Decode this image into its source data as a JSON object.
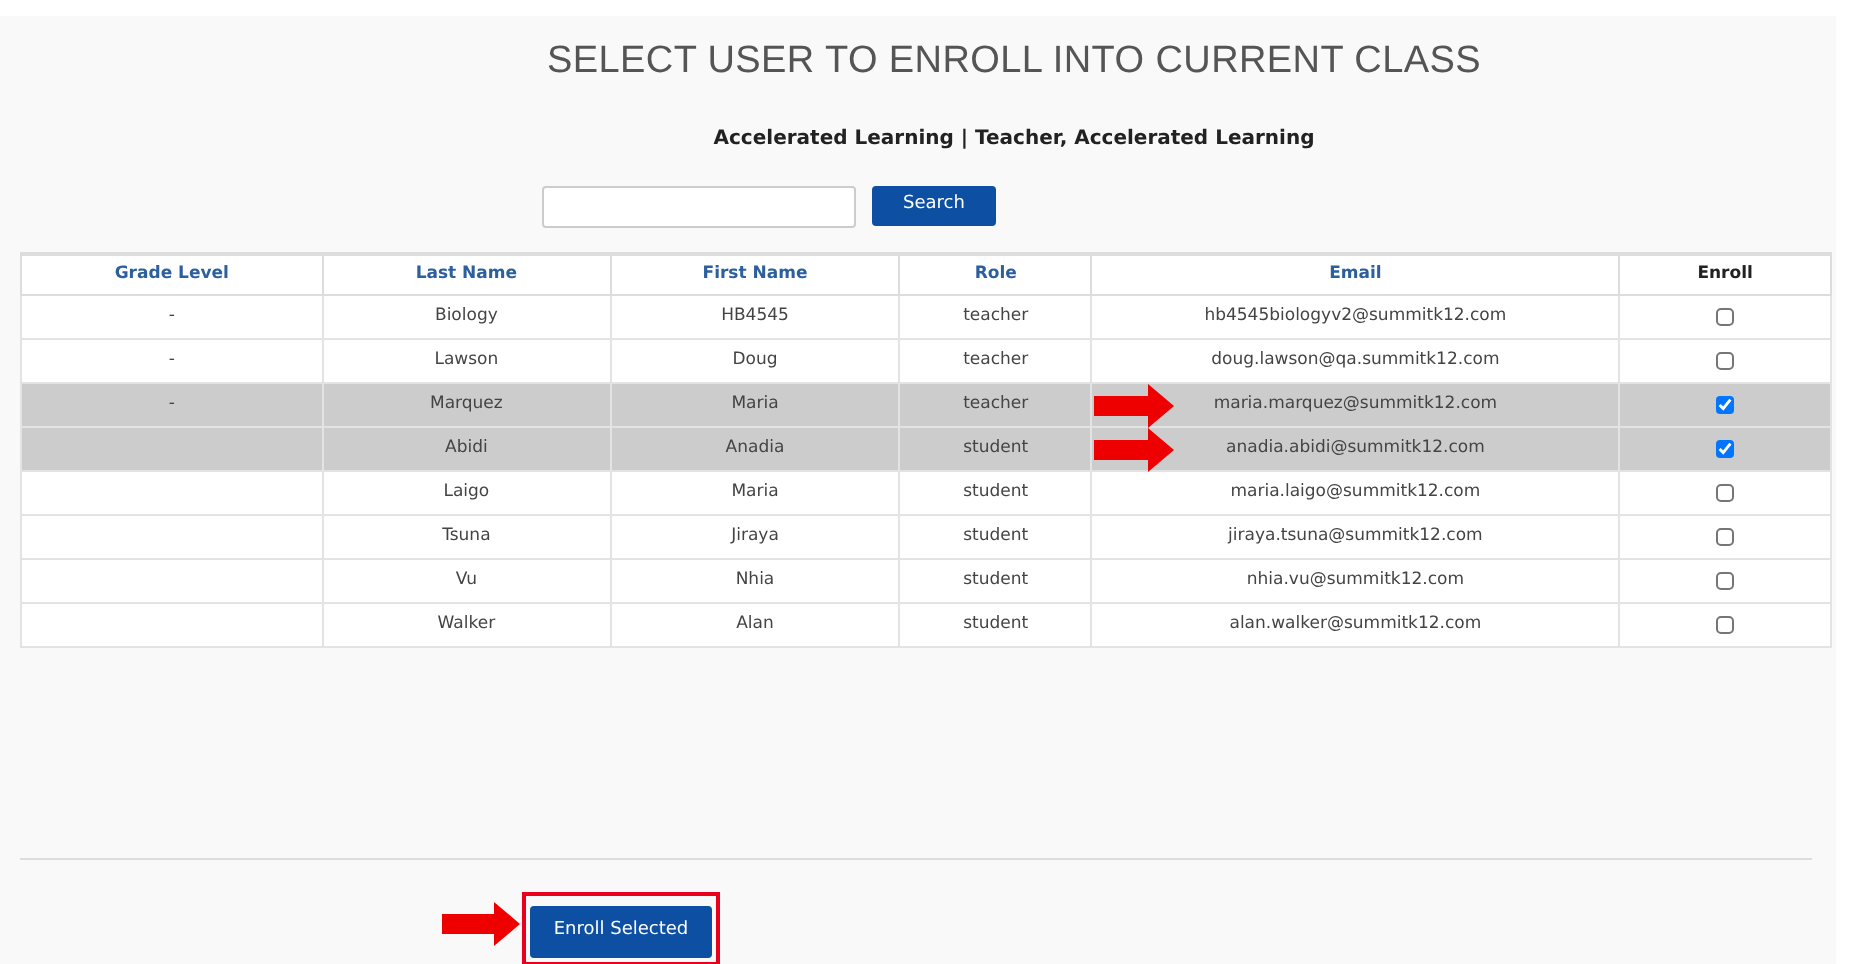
{
  "title": "SELECT USER TO ENROLL INTO CURRENT CLASS",
  "subtitle": "Accelerated Learning | Teacher, Accelerated Learning",
  "search": {
    "button": "Search"
  },
  "table": {
    "columns": [
      "Grade Level",
      "Last Name",
      "First Name",
      "Role",
      "Email",
      "Enroll"
    ],
    "rows": [
      {
        "grade": "-",
        "last": "Biology",
        "first": "HB4545",
        "role": "teacher",
        "email": "hb4545biologyv2@summitk12.com",
        "checked": false,
        "arrow": false
      },
      {
        "grade": "-",
        "last": "Lawson",
        "first": "Doug",
        "role": "teacher",
        "email": "doug.lawson@qa.summitk12.com",
        "checked": false,
        "arrow": false
      },
      {
        "grade": "-",
        "last": "Marquez",
        "first": "Maria",
        "role": "teacher",
        "email": "maria.marquez@summitk12.com",
        "checked": true,
        "arrow": true
      },
      {
        "last": "Abidi",
        "first": "Anadia",
        "role": "student",
        "email": "anadia.abidi@summitk12.com",
        "checked": true,
        "arrow": true
      },
      {
        "last": "Laigo",
        "first": "Maria",
        "role": "student",
        "email": "maria.laigo@summitk12.com",
        "checked": false,
        "arrow": false
      },
      {
        "last": "Tsuna",
        "first": "Jiraya",
        "role": "student",
        "email": "jiraya.tsuna@summitk12.com",
        "checked": false,
        "arrow": false
      },
      {
        "last": "Vu",
        "first": "Nhia",
        "role": "student",
        "email": "nhia.vu@summitk12.com",
        "checked": false,
        "arrow": false
      },
      {
        "last": "Walker",
        "first": "Alan",
        "role": "student",
        "email": "alan.walker@summitk12.com",
        "checked": false,
        "arrow": false
      }
    ]
  },
  "enroll_button": {
    "label": "Enroll Selected",
    "highlighted": true
  }
}
